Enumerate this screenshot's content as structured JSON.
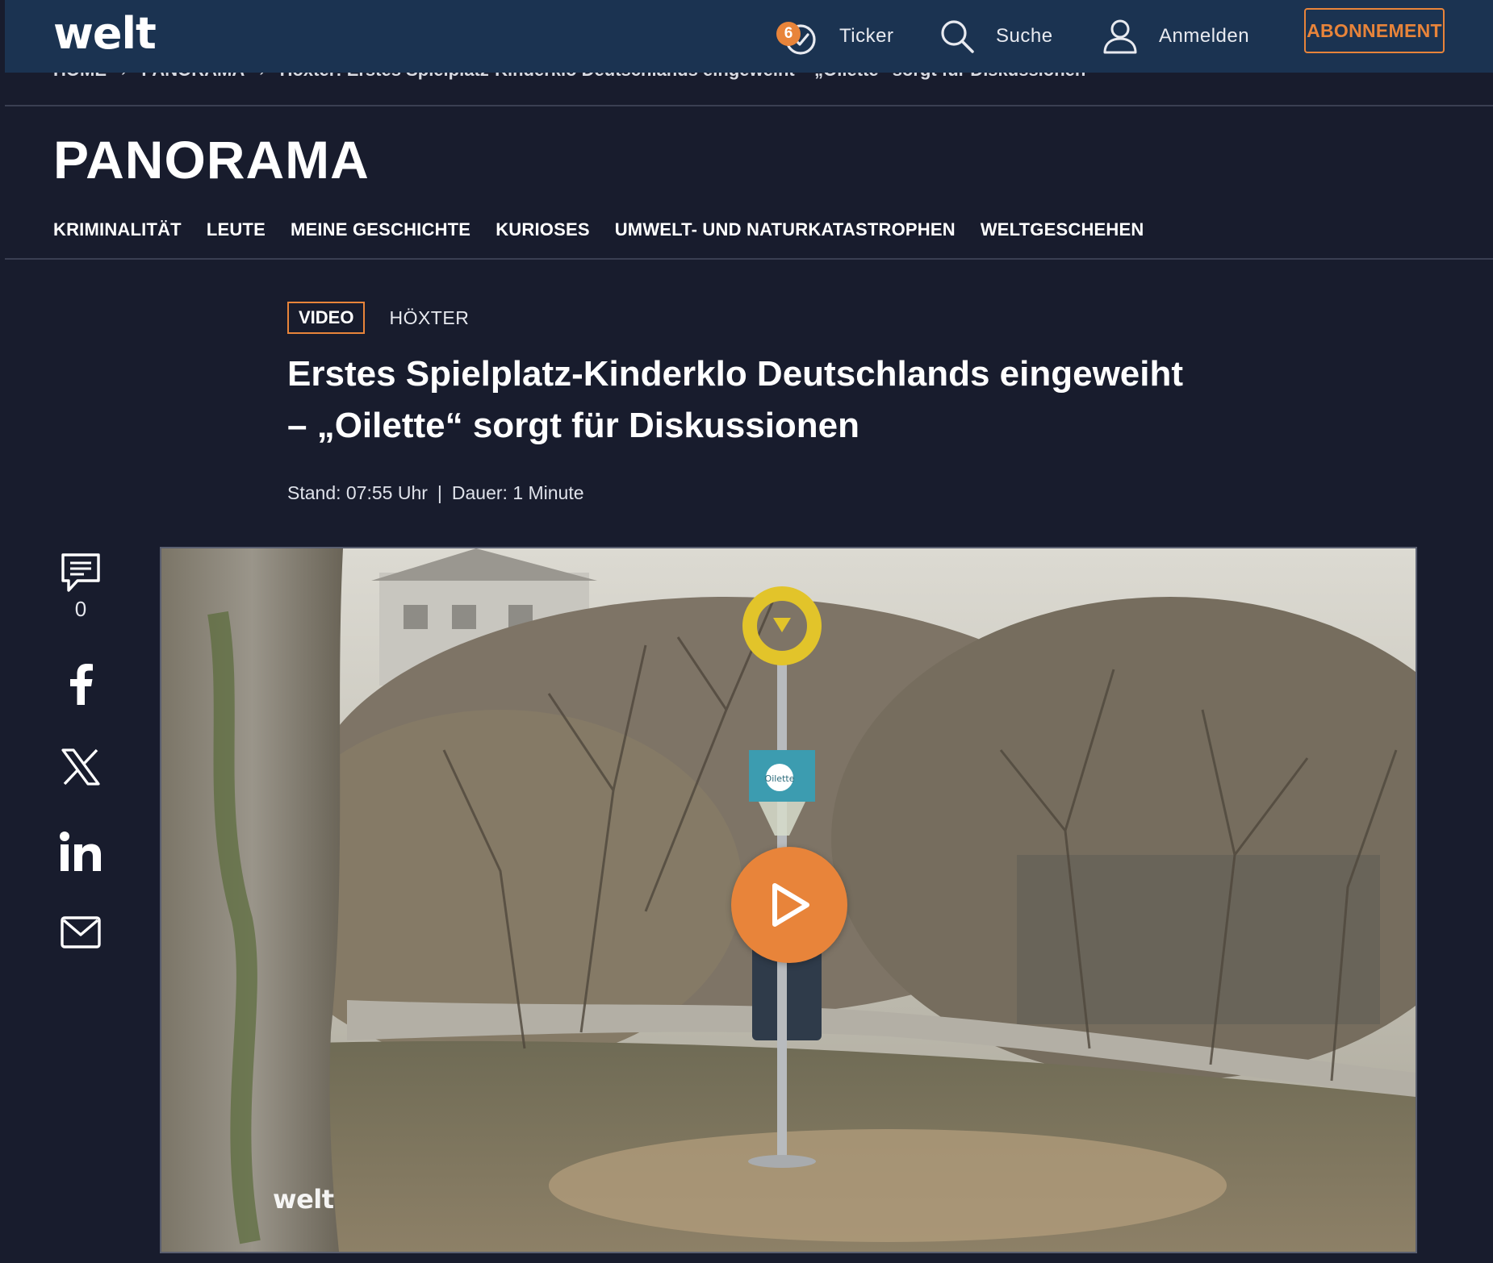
{
  "header": {
    "logo": "welt",
    "ticker_label": "Ticker",
    "ticker_badge": "6",
    "search_label": "Suche",
    "login_label": "Anmelden",
    "subscribe_label": "ABONNEMENT"
  },
  "breadcrumb": {
    "items": [
      "HOME",
      "PANORAMA",
      "Höxter: Erstes Spielplatz-Kinderklo Deutschlands eingeweiht – „Oilette“ sorgt für Diskussionen"
    ]
  },
  "section": {
    "title": "PANORAMA",
    "subnav": [
      "KRIMINALITÄT",
      "LEUTE",
      "MEINE GESCHICHTE",
      "KURIOSES",
      "UMWELT- UND NATURKATASTROPHEN",
      "WELTGESCHEHEN"
    ]
  },
  "article": {
    "tag": "VIDEO",
    "location": "HÖXTER",
    "headline_line1": "Erstes Spielplatz-Kinderklo Deutschlands eingeweiht",
    "headline_line2": "– „Oilette“ sorgt für Diskussionen",
    "stand": "Stand: 07:55 Uhr",
    "dauer": "Dauer: 1 Minute"
  },
  "social": {
    "comment_count": "0",
    "icons": [
      "comment-icon",
      "facebook-icon",
      "x-icon",
      "linkedin-icon",
      "mail-icon"
    ]
  },
  "video": {
    "watermark": "welt",
    "sign_text": "Oilette"
  },
  "colors": {
    "background": "#181c2d",
    "header": "#1b3351",
    "accent": "#e8843a"
  }
}
